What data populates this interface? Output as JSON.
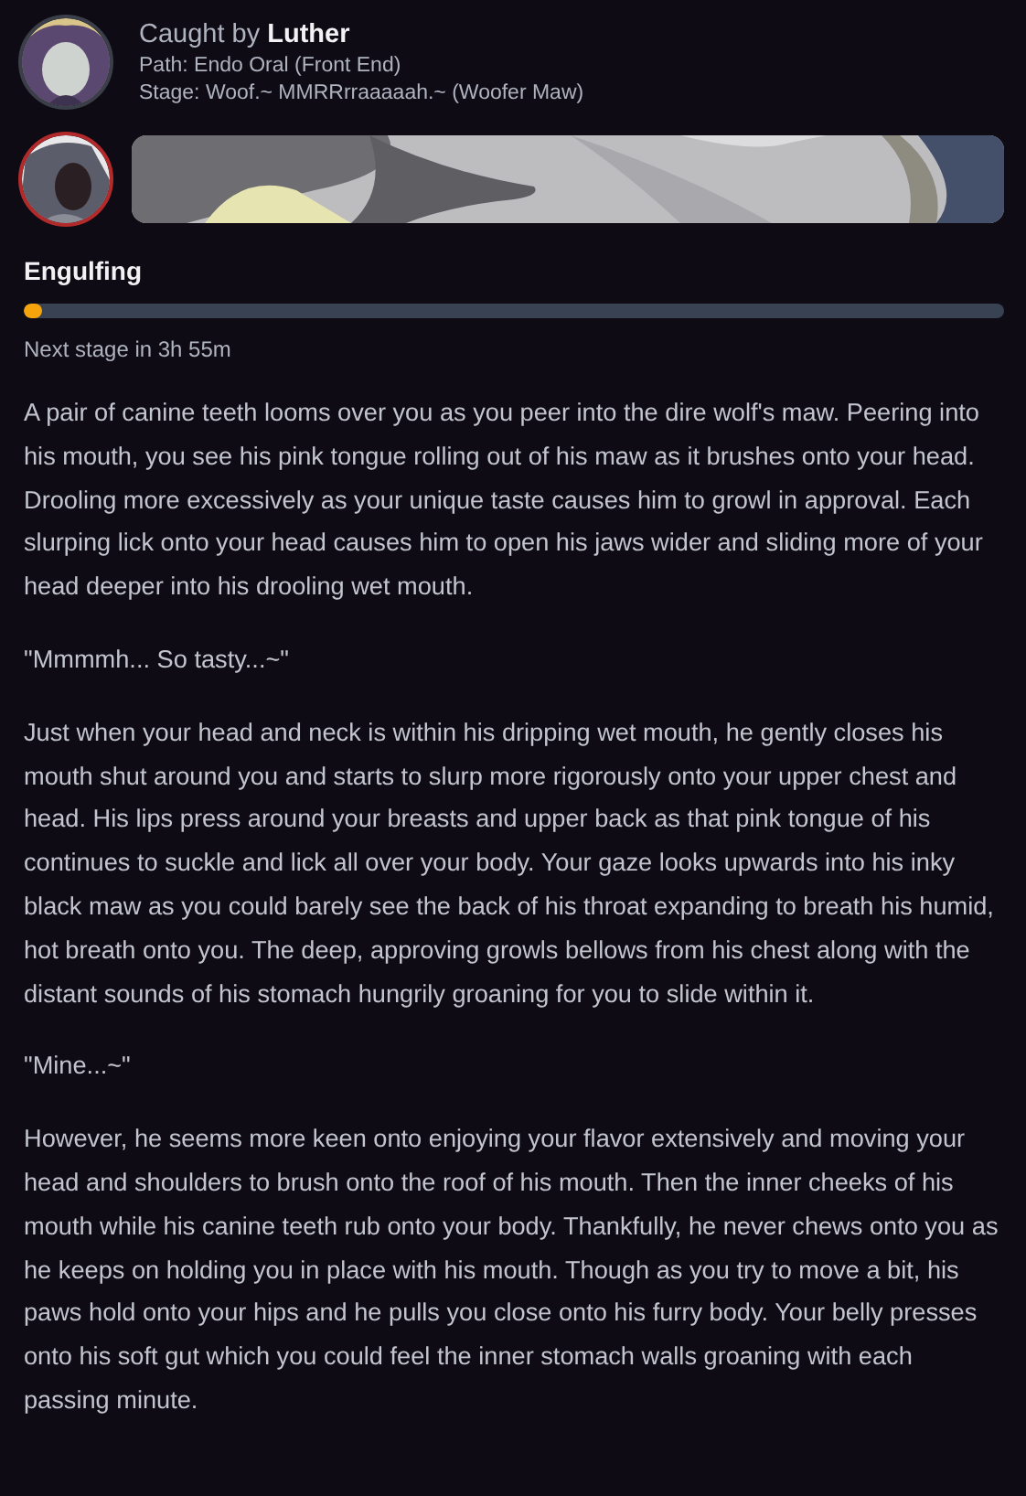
{
  "header": {
    "caught_by_label": "Caught by",
    "predator": "Luther",
    "path": "Path: Endo Oral (Front End)",
    "stage": "Stage: Woof.~ MMRRrraaaaah.~ (Woofer Maw)"
  },
  "progress": {
    "title": "Engulfing",
    "level": 0.018,
    "next_stage": "Next stage in 3h 55m"
  },
  "paragraphs": [
    "A pair of canine teeth looms over you as you peer into the dire wolf's maw. Peering into his mouth, you see his pink tongue rolling out of his maw as it brushes onto your head. Drooling more excessively as your unique taste causes him to growl in approval. Each slurping lick onto your head causes him to open his jaws wider and sliding more of your head deeper into his drooling wet mouth.",
    "\"Mmmmh... So tasty...~\"",
    "Just when your head and neck is within his dripping wet mouth, he gently closes his mouth shut around you and starts to slurp more rigorously onto your upper chest and head. His lips press around your breasts and upper back as that pink tongue of his continues to suckle and lick all over your body. Your gaze looks upwards into his inky black maw as you could barely see the back of his throat expanding to breath his humid, hot breath onto you. The deep, approving growls bellows from his chest along with the distant sounds of his stomach hungrily groaning for you to slide within it.",
    "\"Mine...~\"",
    "However, he seems more keen onto enjoying your flavor extensively and moving your head and shoulders to brush onto the roof of his mouth. Then the inner cheeks of his mouth while his canine teeth rub onto your body. Thankfully, he never chews onto you as he keeps on holding you in place with his mouth. Though as you try to move a bit, his paws hold onto your hips and he pulls you close onto his furry body. Your belly presses onto his soft gut which you could feel the inner stomach walls groaning with each passing minute."
  ]
}
